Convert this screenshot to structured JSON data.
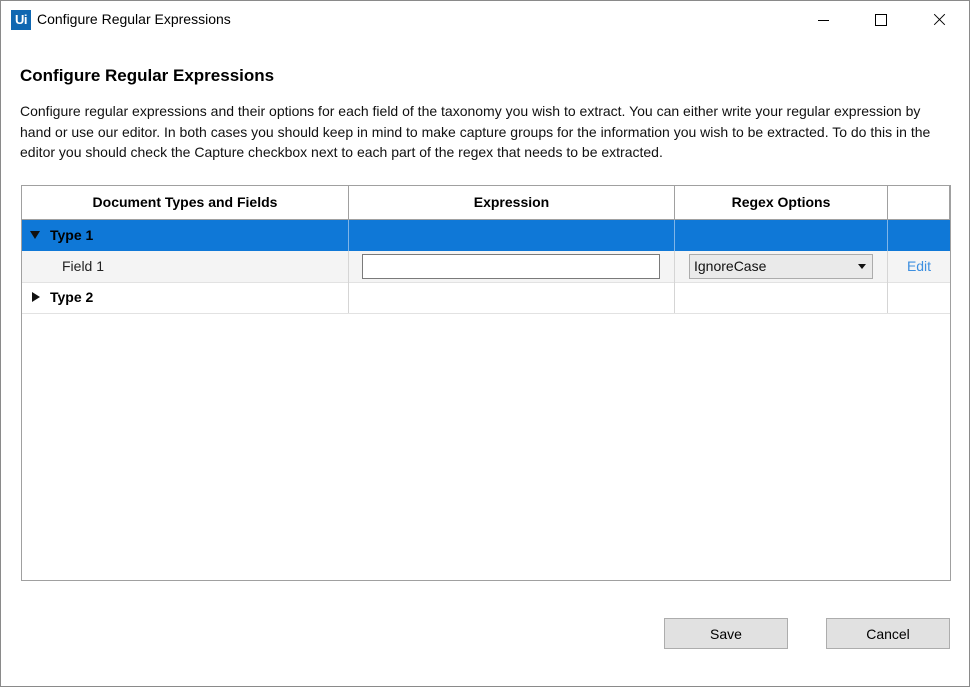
{
  "window": {
    "logo_text": "Ui",
    "title": "Configure Regular Expressions",
    "brand_color": "#0f67b1"
  },
  "main": {
    "heading": "Configure Regular Expressions",
    "description": "Configure regular expressions and their options for each field of the taxonomy you wish to extract. You can either write your regular expression by hand or use our editor. In both cases you should keep in mind to make capture groups for the information you wish to be extracted. To do this in the editor you should check the Capture checkbox next to each part of the regex that needs to be extracted."
  },
  "grid": {
    "columns": [
      "Document Types and Fields",
      "Expression",
      "Regex Options",
      ""
    ],
    "selected_row_color": "#0f78d7",
    "rows": [
      {
        "kind": "type",
        "label": "Type 1",
        "expanded": true,
        "selected": true
      },
      {
        "kind": "field",
        "label": "Field 1",
        "expression": "",
        "regex_option": "IgnoreCase",
        "action": "Edit"
      },
      {
        "kind": "type",
        "label": "Type 2",
        "expanded": false,
        "selected": false
      }
    ]
  },
  "footer": {
    "save_label": "Save",
    "cancel_label": "Cancel"
  }
}
